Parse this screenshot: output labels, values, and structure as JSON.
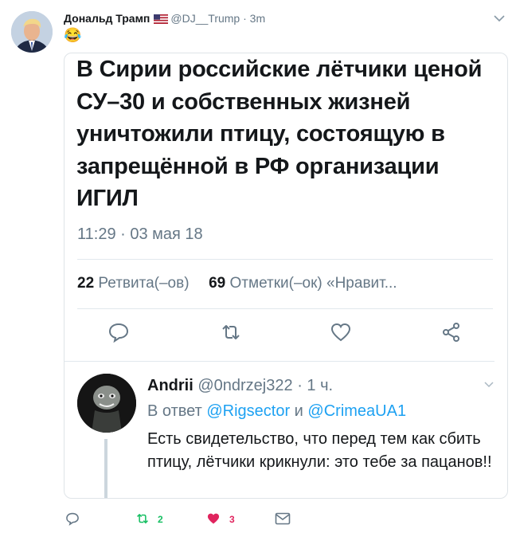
{
  "tweet": {
    "author_name": "Дональд Трамп",
    "handle": "@DJ__Trump",
    "separator": "·",
    "time": "3m",
    "text": "😂"
  },
  "card": {
    "headline": "В Сирии российские лётчики ценой  СУ–30 и собственных жизней уничтожили птицу, состоящую в запрещённой в РФ организации ИГИЛ",
    "timestamp": "11:29 · 03 мая 18",
    "stats": {
      "retweets_count": "22",
      "retweets_label": "Ретвита(–ов)",
      "likes_count": "69",
      "likes_label": "Отметки(–ок) «Нравит..."
    },
    "reply": {
      "author_name": "Andrii",
      "handle": "@0ndrzej322",
      "separator": "·",
      "time": "1 ч.",
      "in_reply_prefix": "В ответ",
      "mention_1": "@Rigsector",
      "conjunction": "и",
      "mention_2": "@CrimeaUA1",
      "text": "Есть свидетельство, что перед тем как сбить птицу, лётчики крикнули: это тебе за пацанов!!"
    }
  },
  "actions": {
    "retweet_count": "2",
    "like_count": "3"
  },
  "colors": {
    "muted": "#657786",
    "link": "#1da1f2",
    "retweet": "#17bf63",
    "like": "#e0245e"
  }
}
